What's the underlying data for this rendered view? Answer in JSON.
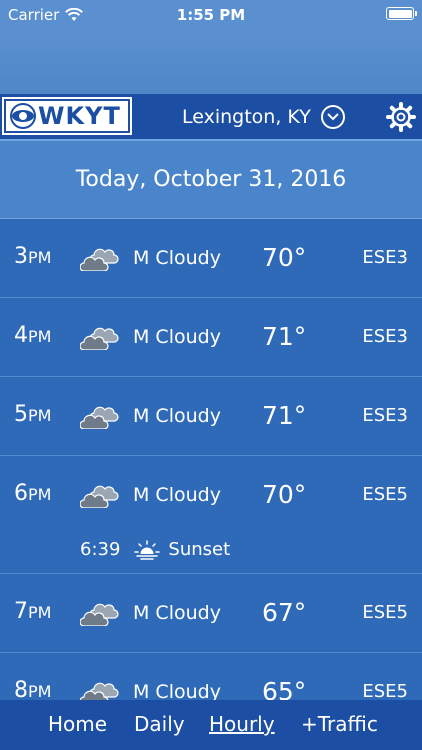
{
  "status_bar": {
    "carrier": "Carrier",
    "time": "1:55 PM"
  },
  "header": {
    "logo_text": "WKYT",
    "location": "Lexington, KY"
  },
  "date_label": "Today, October 31, 2016",
  "hourly": [
    {
      "hour": "3",
      "ampm": "PM",
      "condition": "M Cloudy",
      "temp": "70°",
      "wind": "ESE3"
    },
    {
      "hour": "4",
      "ampm": "PM",
      "condition": "M Cloudy",
      "temp": "71°",
      "wind": "ESE3"
    },
    {
      "hour": "5",
      "ampm": "PM",
      "condition": "M Cloudy",
      "temp": "71°",
      "wind": "ESE3"
    },
    {
      "hour": "6",
      "ampm": "PM",
      "condition": "M Cloudy",
      "temp": "70°",
      "wind": "ESE5"
    },
    {
      "hour": "7",
      "ampm": "PM",
      "condition": "M Cloudy",
      "temp": "67°",
      "wind": "ESE5"
    },
    {
      "hour": "8",
      "ampm": "PM",
      "condition": "M Cloudy",
      "temp": "65°",
      "wind": "ESE5"
    }
  ],
  "sunset": {
    "time": "6:39",
    "label": "Sunset"
  },
  "tabs": {
    "home": "Home",
    "daily": "Daily",
    "hourly": "Hourly",
    "traffic": "+Traffic"
  },
  "icons": {
    "wifi": "wifi-icon",
    "battery": "battery-icon",
    "chevron": "chevron-down-icon",
    "gear": "gear-icon",
    "cloud": "cloud-icon",
    "sunset": "sunset-icon"
  }
}
